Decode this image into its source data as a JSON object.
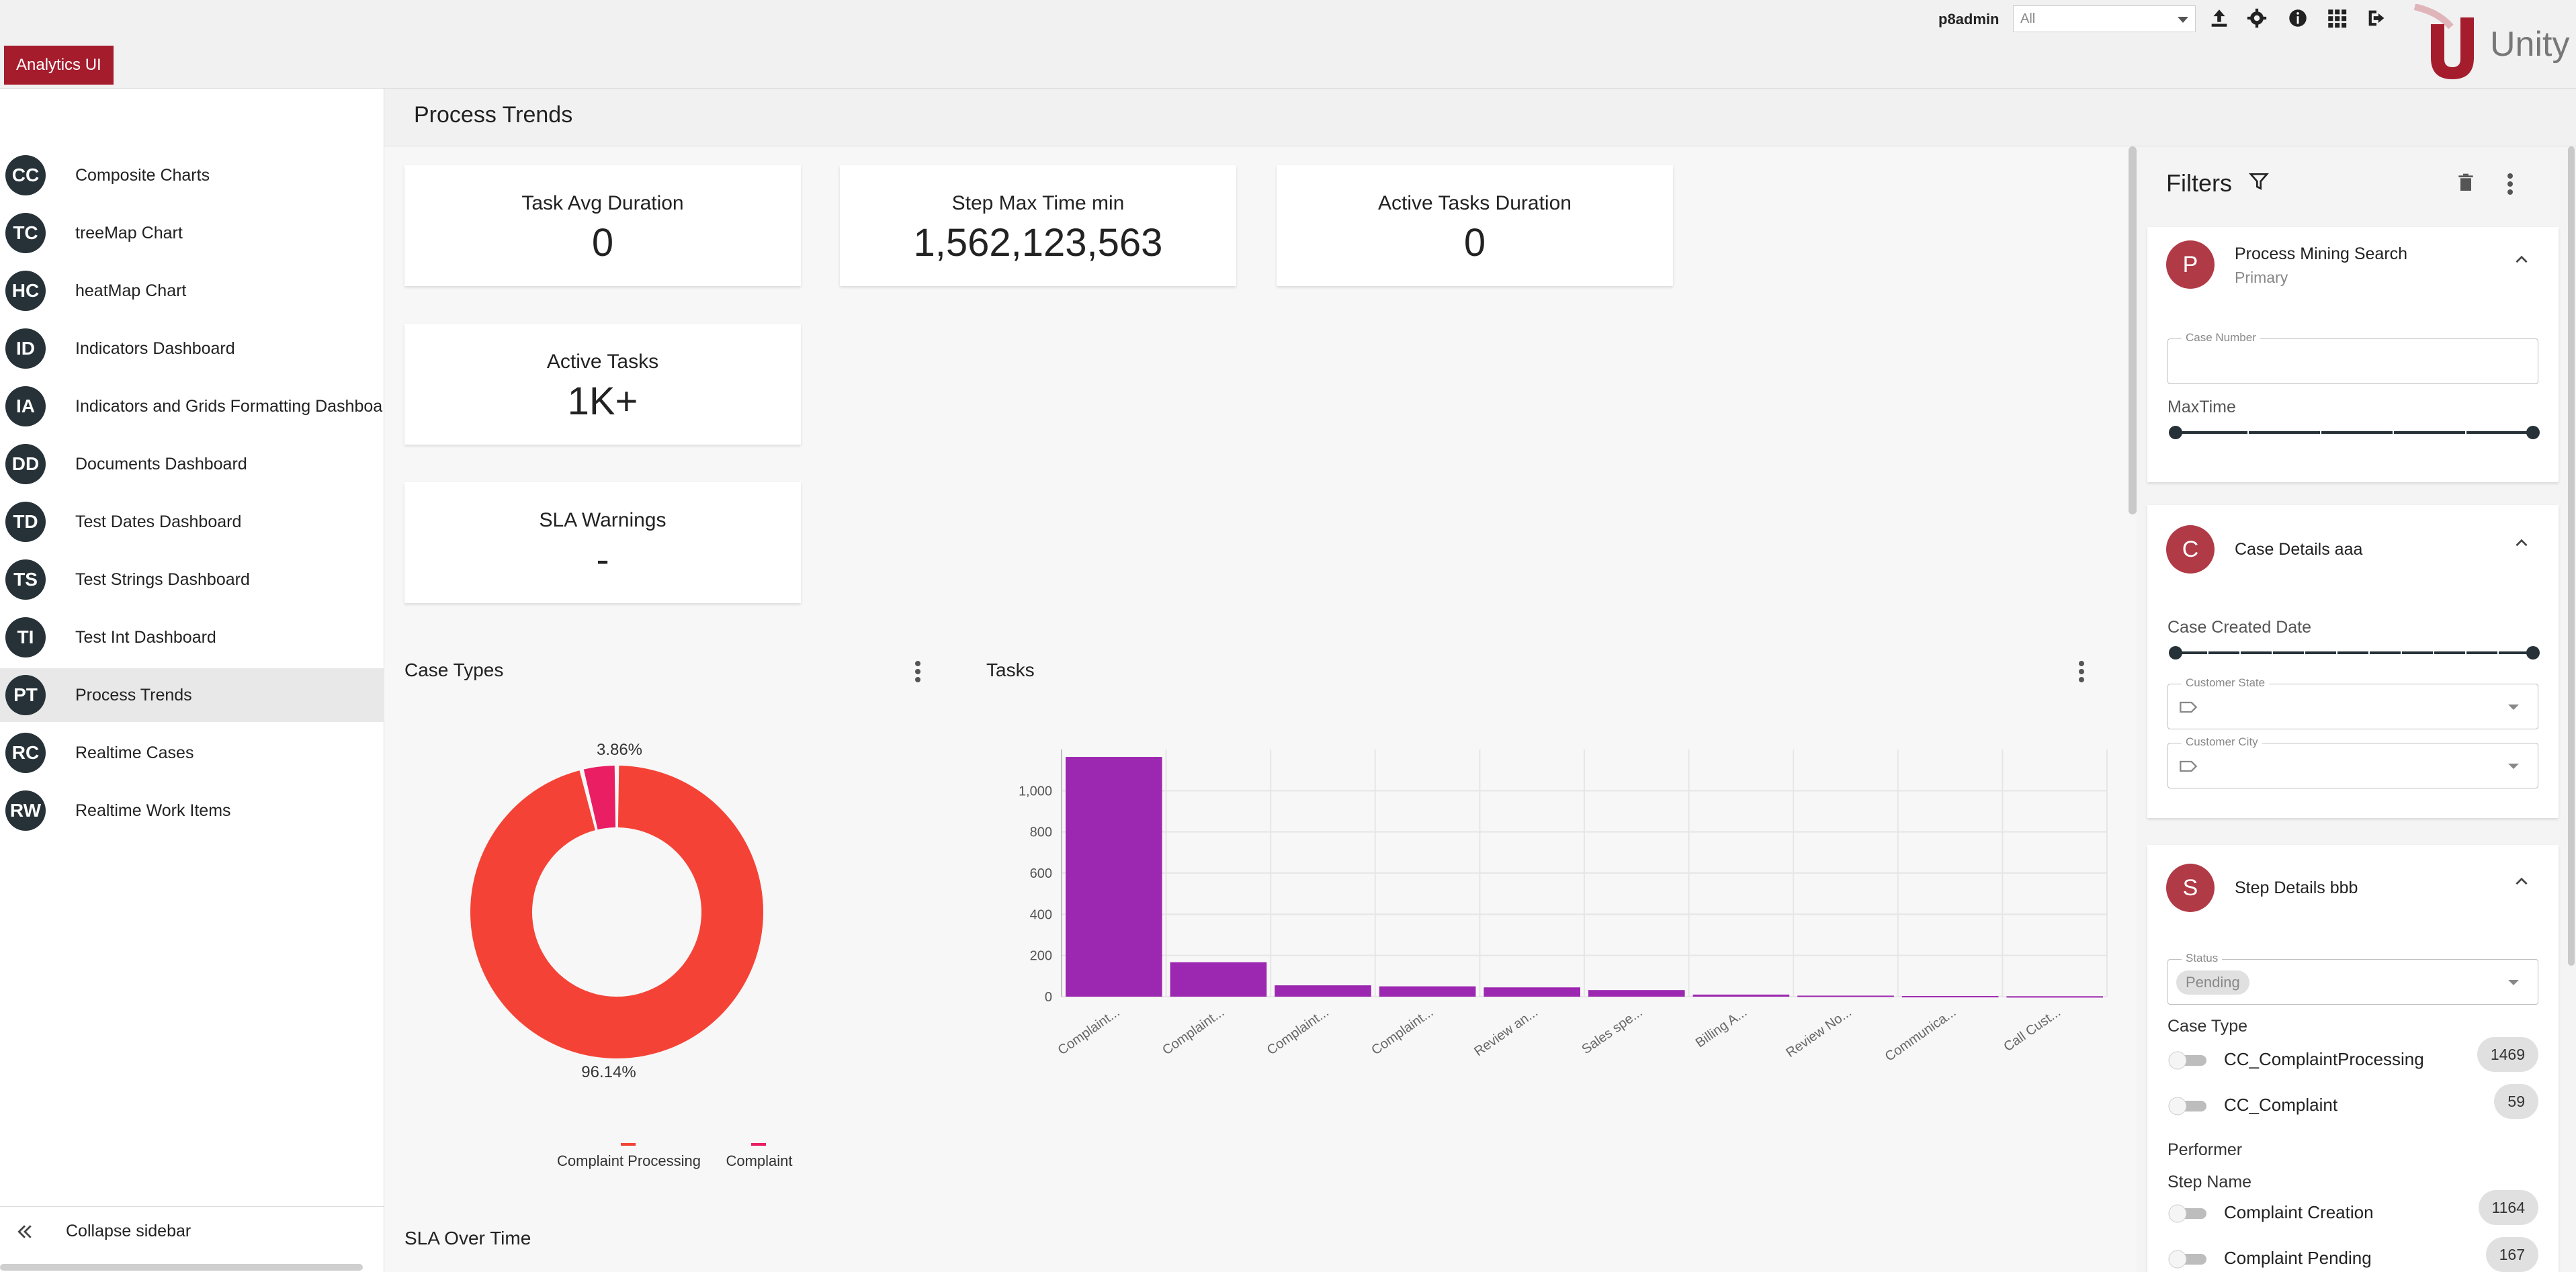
{
  "header": {
    "app_tag": "Analytics UI",
    "user": "p8admin",
    "scope_value": "All",
    "brand": "Unity"
  },
  "toolbar_icons": [
    "upload-icon",
    "gear-icon",
    "info-icon",
    "apps-grid-icon",
    "logout-icon"
  ],
  "sidebar": {
    "items": [
      {
        "initials": "CC",
        "label": "Composite Charts"
      },
      {
        "initials": "TC",
        "label": "treeMap Chart"
      },
      {
        "initials": "HC",
        "label": "heatMap Chart"
      },
      {
        "initials": "ID",
        "label": "Indicators Dashboard"
      },
      {
        "initials": "IA",
        "label": "Indicators and Grids Formatting Dashboard"
      },
      {
        "initials": "DD",
        "label": "Documents Dashboard"
      },
      {
        "initials": "TD",
        "label": "Test Dates Dashboard"
      },
      {
        "initials": "TS",
        "label": "Test Strings Dashboard"
      },
      {
        "initials": "TI",
        "label": "Test Int Dashboard"
      },
      {
        "initials": "PT",
        "label": "Process Trends"
      },
      {
        "initials": "RC",
        "label": "Realtime Cases"
      },
      {
        "initials": "RW",
        "label": "Realtime Work Items"
      }
    ],
    "active_index": 9,
    "collapse_label": "Collapse sidebar"
  },
  "page": {
    "title": "Process Trends",
    "kpis": [
      {
        "label": "Task Avg Duration",
        "value": "0"
      },
      {
        "label": "Step Max Time min",
        "value": "1,562,123,563"
      },
      {
        "label": "Active Tasks Duration",
        "value": "0"
      },
      {
        "label": "Active Tasks",
        "value": "1K+"
      },
      {
        "label": "SLA Warnings",
        "value": "-"
      }
    ],
    "case_types_title": "Case Types",
    "tasks_title": "Tasks",
    "sla_title": "SLA Over Time"
  },
  "chart_data": [
    {
      "type": "pie",
      "title": "Case Types",
      "categories": [
        "Complaint Processing",
        "Complaint"
      ],
      "values": [
        96.14,
        3.86
      ],
      "labels": [
        "96.14%",
        "3.86%"
      ],
      "colors": [
        "#f44336",
        "#e91e63"
      ],
      "legend": "bottom"
    },
    {
      "type": "bar",
      "title": "Tasks",
      "categories": [
        "Complaint...",
        "Complaint...",
        "Complaint...",
        "Complaint...",
        "Review an...",
        "Sales spe...",
        "Billing A...",
        "Review No...",
        "Communica...",
        "Call Cust..."
      ],
      "values": [
        1164,
        167,
        55,
        50,
        45,
        32,
        10,
        5,
        3,
        2
      ],
      "ylim": [
        0,
        1200
      ],
      "yticks": [
        "0",
        "200",
        "400",
        "600",
        "800",
        "1,000"
      ],
      "grid": true,
      "color": "#9c27b0"
    }
  ],
  "filters": {
    "title": "Filters",
    "process": {
      "avatar": "P",
      "title": "Process Mining Search",
      "subtitle": "Primary",
      "case_number_label": "Case Number",
      "case_number_value": "",
      "maxtime_label": "MaxTime"
    },
    "case": {
      "avatar": "C",
      "title": "Case Details aaa",
      "created_label": "Case Created Date",
      "state_label": "Customer State",
      "city_label": "Customer City"
    },
    "step": {
      "avatar": "S",
      "title": "Step Details bbb",
      "status_label": "Status",
      "status_value": "Pending",
      "case_type_label": "Case Type",
      "case_types": [
        {
          "label": "CC_ComplaintProcessing",
          "count": "1469"
        },
        {
          "label": "CC_Complaint",
          "count": "59"
        }
      ],
      "performer_label": "Performer",
      "step_name_label": "Step Name",
      "step_names": [
        {
          "label": "Complaint Creation",
          "count": "1164"
        },
        {
          "label": "Complaint Pending",
          "count": "167"
        }
      ]
    }
  }
}
